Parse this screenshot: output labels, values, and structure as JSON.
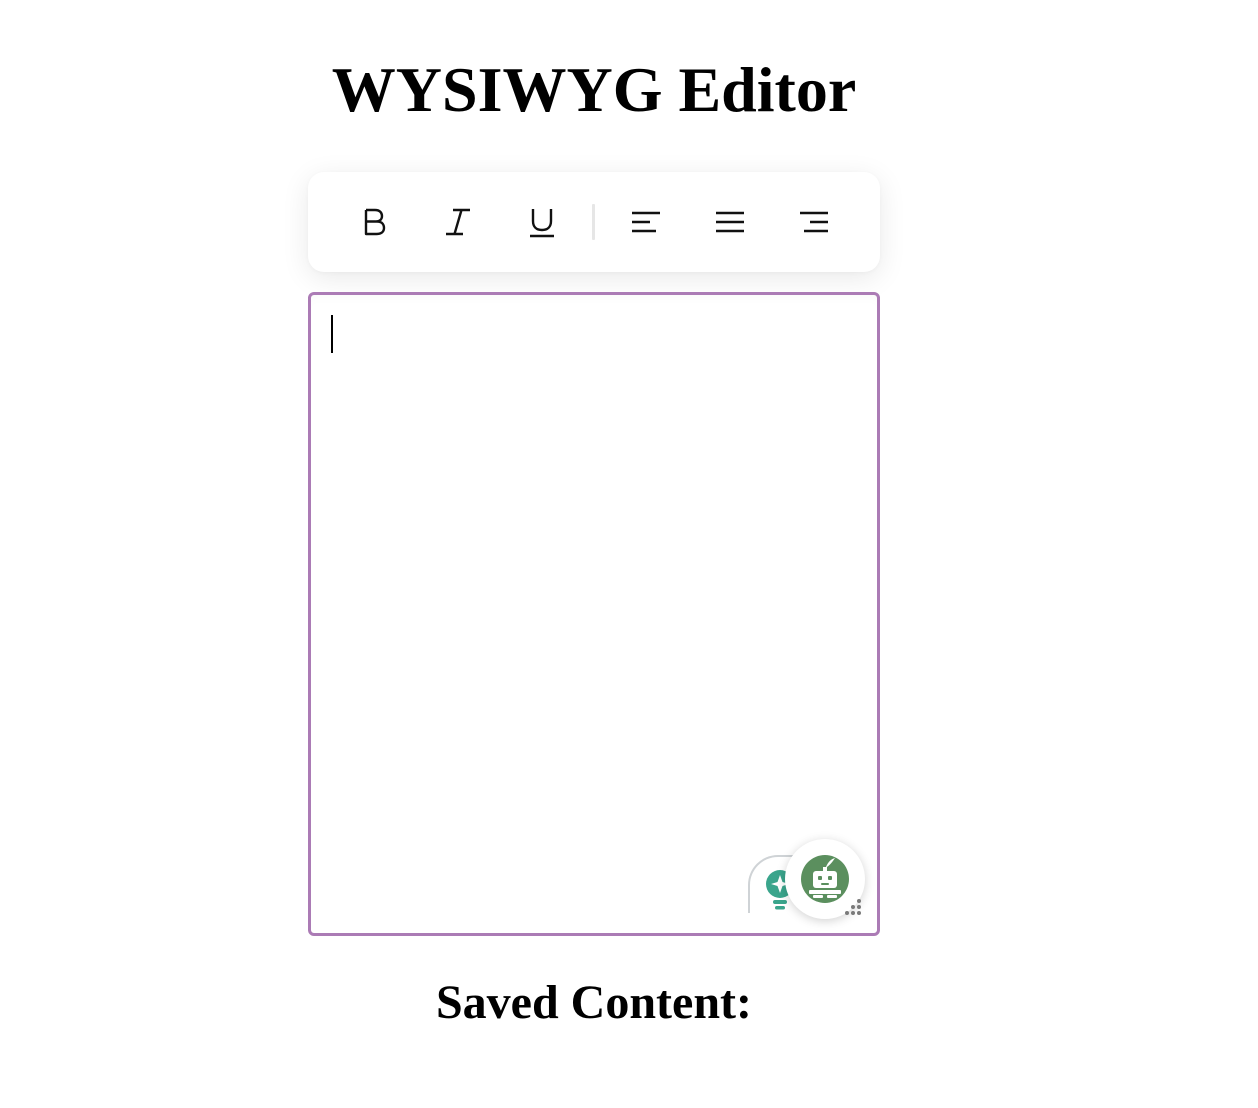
{
  "page": {
    "title": "WYSIWYG Editor"
  },
  "toolbar": {
    "buttons": [
      {
        "name": "bold",
        "icon": "bold-icon"
      },
      {
        "name": "italic",
        "icon": "italic-icon"
      },
      {
        "name": "underline",
        "icon": "underline-icon"
      },
      {
        "name": "align-left",
        "icon": "align-left-icon"
      },
      {
        "name": "align-center",
        "icon": "align-justify-icon"
      },
      {
        "name": "align-right",
        "icon": "align-right-icon"
      }
    ]
  },
  "editor": {
    "content": "",
    "border_color": "#ab7bb5",
    "overlays": [
      {
        "name": "grammar-assistant-extension",
        "icon": "lightbulb-sparkle-icon",
        "color": "#3aa58c"
      },
      {
        "name": "writing-bot-extension",
        "icon": "robot-quill-icon",
        "color": "#5b8f5e"
      }
    ]
  },
  "saved": {
    "heading": "Saved Content:",
    "content": ""
  }
}
